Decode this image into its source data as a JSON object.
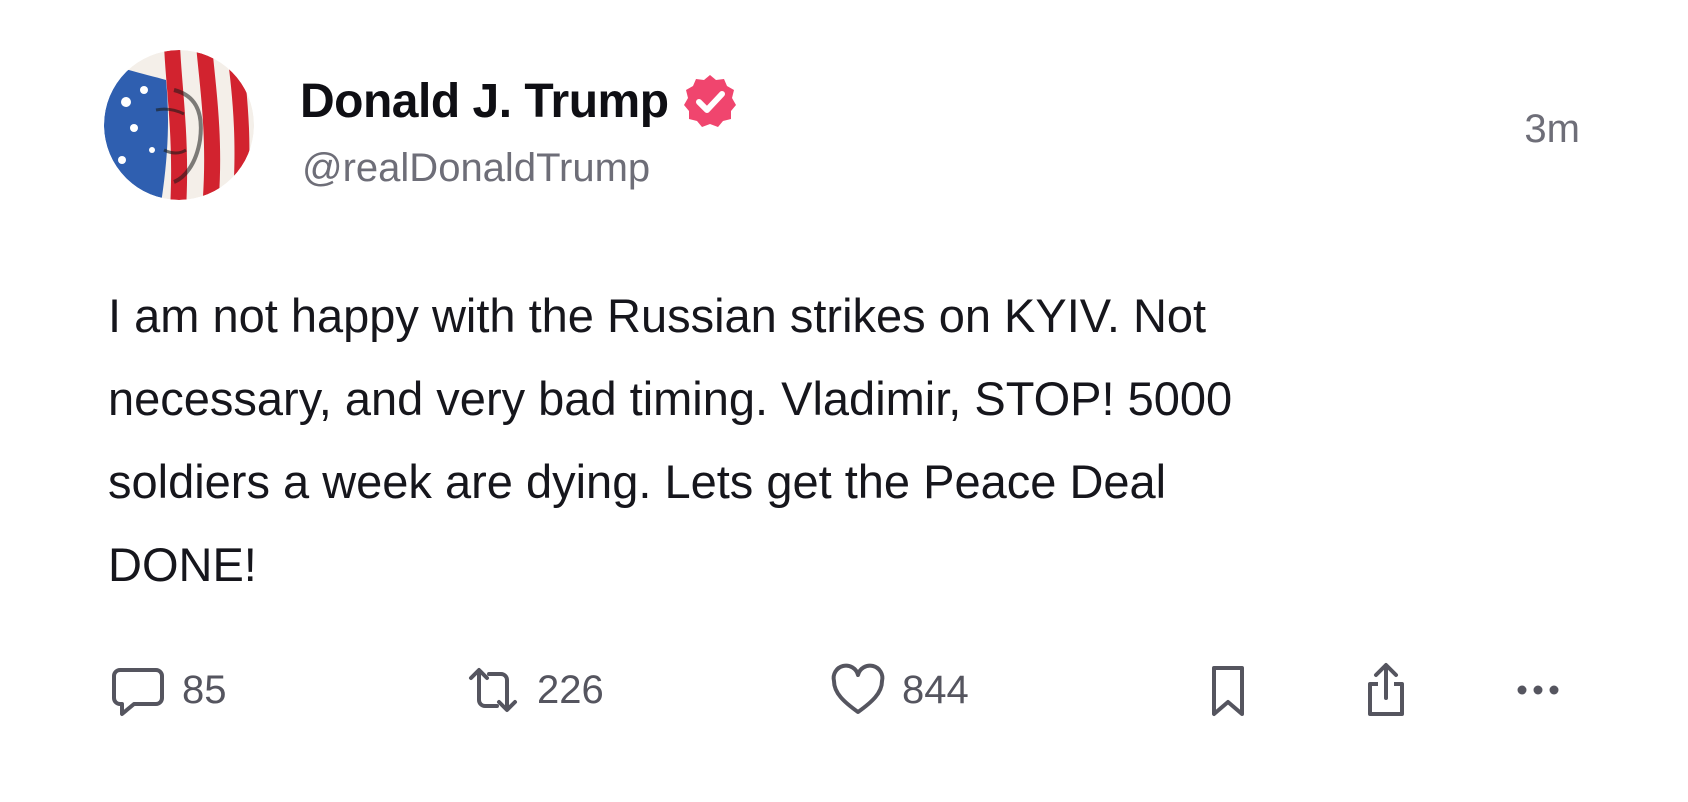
{
  "post": {
    "author": {
      "display_name": "Donald J. Trump",
      "handle": "@realDonaldTrump",
      "verified": true,
      "verified_color": "#f0456e"
    },
    "timestamp": "3m",
    "text": "I am not happy with the Russian strikes on KYIV. Not\nnecessary, and very bad timing. Vladimir, STOP! 5000\nsoldiers a week are dying. Lets get the Peace Deal\nDONE!",
    "actions": {
      "reply": {
        "icon": "speech-bubble-icon",
        "count": "85"
      },
      "retruth": {
        "icon": "repost-arrows-icon",
        "count": "226"
      },
      "like": {
        "icon": "heart-icon",
        "count": "844"
      },
      "bookmark": {
        "icon": "bookmark-icon"
      },
      "share": {
        "icon": "share-icon"
      },
      "more": {
        "icon": "more-dots-icon"
      }
    }
  },
  "colors": {
    "text": "#16161c",
    "muted": "#6e6e78",
    "icon": "#55555f",
    "background": "#ffffff"
  }
}
